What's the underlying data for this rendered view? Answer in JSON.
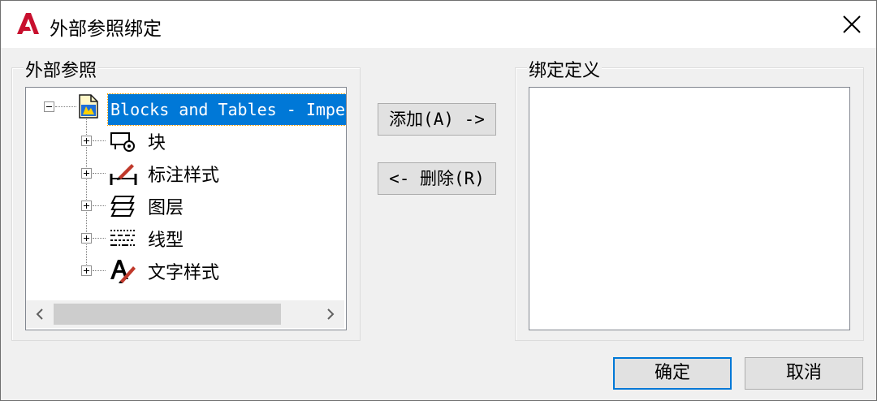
{
  "window": {
    "title": "外部参照绑定",
    "app_icon": "autocad-a-icon",
    "close_icon": "close-icon"
  },
  "xref_panel": {
    "legend": "外部参照",
    "root": {
      "label": "Blocks and Tables - Impe",
      "icon": "drawing-file-icon",
      "expanded": true
    },
    "children": [
      {
        "label": "块",
        "icon": "block-icon"
      },
      {
        "label": "标注样式",
        "icon": "dimension-style-icon"
      },
      {
        "label": "图层",
        "icon": "layers-icon"
      },
      {
        "label": "线型",
        "icon": "linetype-icon"
      },
      {
        "label": "文字样式",
        "icon": "text-style-icon"
      }
    ],
    "scroll_left": "‹",
    "scroll_right": "›"
  },
  "buttons": {
    "add": "添加(A) ->",
    "remove": "<- 删除(R)",
    "ok": "确定",
    "cancel": "取消"
  },
  "bind_panel": {
    "legend": "绑定定义"
  },
  "colors": {
    "selection": "#0078d7",
    "app_red": "#c8102e",
    "default_button_border": "#0078d7"
  }
}
